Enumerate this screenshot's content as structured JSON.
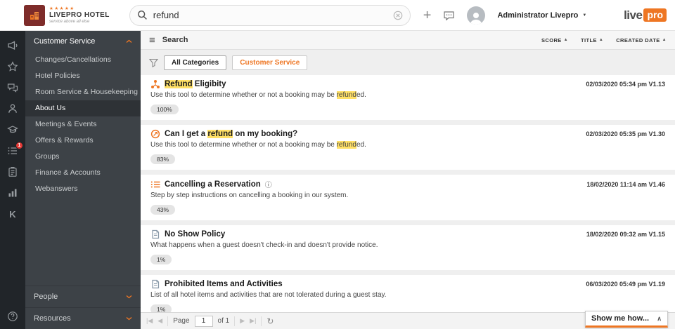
{
  "colors": {
    "accent": "#ee7623",
    "highlight": "#ffe066",
    "badge_red": "#e53935",
    "logo_maroon": "#7e2c2a",
    "rail_bg": "#212529",
    "menu_bg": "#3d4247"
  },
  "header": {
    "hotel": {
      "stars": "★★★★★",
      "name": "LIVEPRO HOTEL",
      "tagline": "service above all else"
    },
    "search_value": "refund",
    "user_name": "Administrator Livepro",
    "brand_live": "live",
    "brand_pro": "pro"
  },
  "rail_icons": [
    "announcements",
    "favorites",
    "conversations",
    "contacts",
    "training",
    "activity-feed",
    "tasks",
    "reports",
    "knowledge",
    "help"
  ],
  "rail_badge": "1",
  "sidebar": {
    "customer_service": {
      "label": "Customer Service",
      "items": [
        "Changes/Cancellations",
        "Hotel Policies",
        "Room Service & Housekeeping",
        "About Us",
        "Meetings & Events",
        "Offers & Rewards",
        "Groups",
        "Finance & Accounts",
        "Webanswers"
      ],
      "active_item": "About Us"
    },
    "people": {
      "label": "People"
    },
    "resources": {
      "label": "Resources"
    }
  },
  "main": {
    "toolbar": {
      "title": "Search",
      "sort_score": "SCORE",
      "sort_title": "TITLE",
      "sort_created": "CREATED DATE",
      "sort_arrow": "▲"
    },
    "filters": {
      "all": "All Categories",
      "category": "Customer Service"
    },
    "results": [
      {
        "title_pre": "",
        "title_hl": "Refund",
        "title_post": " Eligibity",
        "info": "",
        "date": "02/03/2020 05:34 pm V1.13",
        "desc_pre": "Use this tool to determine whether or not a booking may be ",
        "desc_hl": "refund",
        "desc_post": "ed.",
        "score": "100%"
      },
      {
        "title_pre": "Can I get a ",
        "title_hl": "refund",
        "title_post": " on my booking?",
        "info": "",
        "date": "02/03/2020 05:35 pm V1.30",
        "desc_pre": "Use this tool to determine whether or not a booking may be ",
        "desc_hl": "refund",
        "desc_post": "ed.",
        "score": "83%"
      },
      {
        "title_pre": "Cancelling a Reservation",
        "title_hl": "",
        "title_post": "",
        "info": "ⓘ",
        "date": "18/02/2020 11:14 am V1.46",
        "desc_pre": "Step by step instructions on cancelling a booking in our system.",
        "desc_hl": "",
        "desc_post": "",
        "score": "43%"
      },
      {
        "title_pre": "No Show Policy",
        "title_hl": "",
        "title_post": "",
        "info": "",
        "date": "18/02/2020 09:32 am V1.15",
        "desc_pre": "What happens when a guest doesn't check-in and doesn't provide notice.",
        "desc_hl": "",
        "desc_post": "",
        "score": "1%"
      },
      {
        "title_pre": "Prohibited Items and Activities",
        "title_hl": "",
        "title_post": "",
        "info": "",
        "date": "06/03/2020 05:49 pm V1.19",
        "desc_pre": "List of all hotel items and activities that are not tolerated during a guest stay.",
        "desc_hl": "",
        "desc_post": "",
        "score": "1%"
      }
    ]
  },
  "pagination": {
    "page_label": "Page",
    "page_value": "1",
    "of_label": "of 1",
    "first": "|◀",
    "prev": "◀",
    "next": "▶",
    "last": "▶|",
    "refresh": "↻"
  },
  "help_widget": {
    "label": "Show me how...",
    "collapse": "∧"
  }
}
